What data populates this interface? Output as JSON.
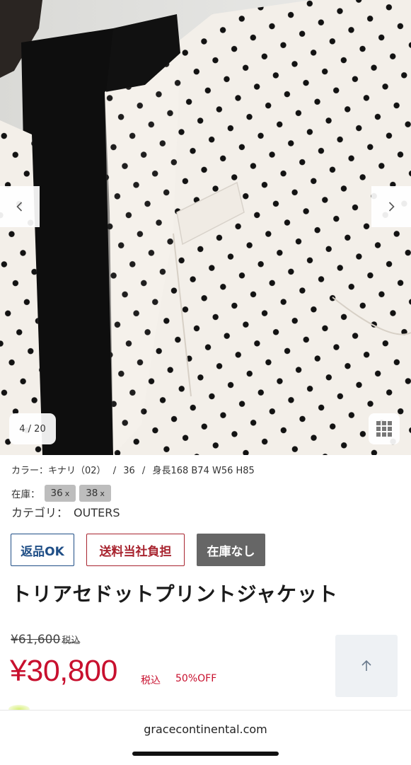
{
  "gallery": {
    "counter": "4 / 20",
    "prev_icon": "chevron-left-icon",
    "next_icon": "chevron-right-icon",
    "grid_icon": "grid-icon"
  },
  "product": {
    "color_line": {
      "color": "カラー：キナリ（02）",
      "size": "36",
      "model": "身長168 B74 W56 H85"
    },
    "stock": {
      "label": "在庫：",
      "sizes": [
        "36",
        "38"
      ],
      "x_mark": "x"
    },
    "category": {
      "label": "カテゴリ：",
      "value": "OUTERS"
    },
    "badges": {
      "return": "返品OK",
      "shipping": "送料当社負担",
      "stock": "在庫なし"
    },
    "title": "トリアセドットプリントジャケット",
    "old_price": "¥61,600",
    "old_price_tax": "税込",
    "price": "¥30,800",
    "price_tax": "税込",
    "discount": "50%OFF"
  },
  "scroll_top_icon": "arrow-up-icon",
  "browser": {
    "url": "gracecontinental.com"
  },
  "colors": {
    "sale_red": "#c8102e",
    "return_blue": "#1f4e86",
    "shipping_red": "#a8242f",
    "stock_gray": "#666666"
  }
}
